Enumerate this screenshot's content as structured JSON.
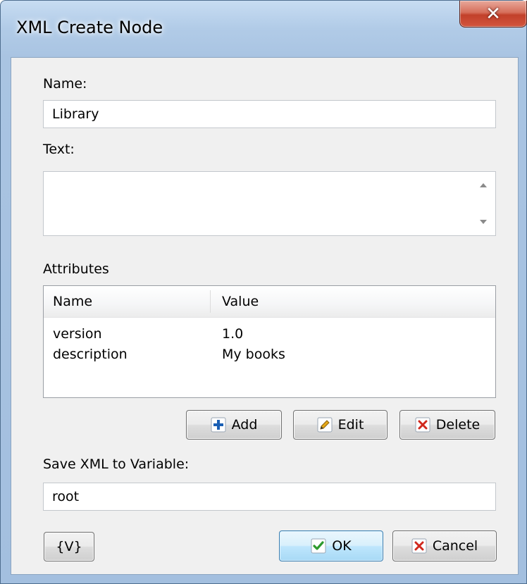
{
  "window": {
    "title": "XML Create Node",
    "close_glyph": "✕"
  },
  "fields": {
    "name_label": "Name:",
    "name_value": "Library",
    "text_label": "Text:",
    "text_value": "",
    "attributes_label": "Attributes",
    "save_label": "Save XML to Variable:",
    "save_value": "root"
  },
  "attributes": {
    "columns": [
      "Name",
      "Value"
    ],
    "rows": [
      {
        "name": "version",
        "value": "1.0"
      },
      {
        "name": "description",
        "value": "My books"
      }
    ]
  },
  "buttons": {
    "add": "Add",
    "edit": "Edit",
    "delete": "Delete",
    "variables": "{V}",
    "ok": "OK",
    "cancel": "Cancel"
  },
  "icons": {
    "add": "plus-icon",
    "edit": "pencil-icon",
    "delete": "x-icon",
    "ok": "checkmark-icon",
    "cancel": "x-icon",
    "close": "close-icon"
  },
  "colors": {
    "titlebar": "#b1cbe7",
    "close_button": "#c2402a",
    "plus_icon": "#1a5fb4",
    "check_icon": "#2e9a2e",
    "x_icon": "#d0281d",
    "pencil_icon": "#e6a817"
  }
}
